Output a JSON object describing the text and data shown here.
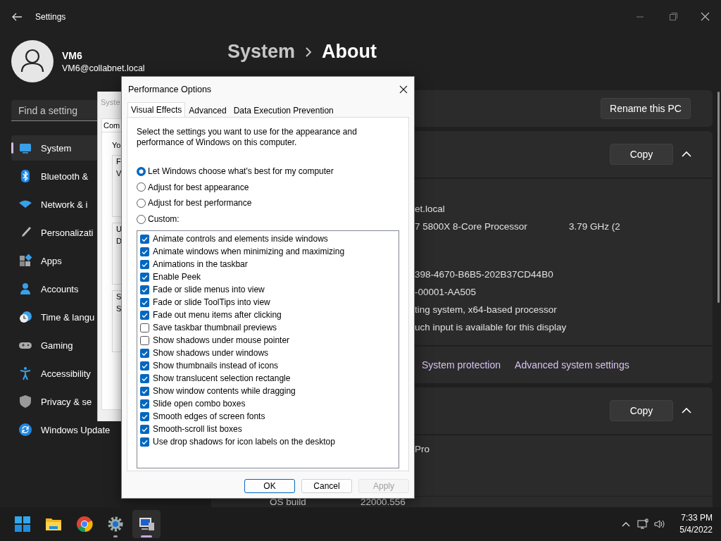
{
  "settings_window": {
    "title": "Settings"
  },
  "profile": {
    "name": "VM6",
    "email": "VM6@collabnet.local"
  },
  "search": {
    "placeholder": "Find a setting"
  },
  "sidebar": {
    "items": [
      {
        "label": "System",
        "selected": true
      },
      {
        "label": "Bluetooth &",
        "selected": false
      },
      {
        "label": "Network & i",
        "selected": false
      },
      {
        "label": "Personalizati",
        "selected": false
      },
      {
        "label": "Apps",
        "selected": false
      },
      {
        "label": "Accounts",
        "selected": false
      },
      {
        "label": "Time & langu",
        "selected": false
      },
      {
        "label": "Gaming",
        "selected": false
      },
      {
        "label": "Accessibility",
        "selected": false
      },
      {
        "label": "Privacy & se",
        "selected": false
      },
      {
        "label": "Windows Update",
        "selected": false
      }
    ]
  },
  "breadcrumb": [
    "System",
    "About"
  ],
  "rename_button": "Rename this PC",
  "device_specs": {
    "copy_button": "Copy",
    "expanded": true,
    "rows": [
      {
        "value": "et.local"
      },
      {
        "value": "7 5800X 8-Core Processor",
        "value_2": "3.79 GHz  (2"
      },
      {
        "value": "398-4670-B6B5-202B37CD44B0"
      },
      {
        "value": "-00001-AA505"
      },
      {
        "value": "ting system, x64-based processor"
      },
      {
        "value": "uch input is available for this display"
      }
    ]
  },
  "related_links": [
    "System protection",
    "Advanced system settings"
  ],
  "windows_specs": {
    "copy_button": "Copy",
    "expanded": true,
    "rows": [
      {
        "value": "Pro"
      }
    ],
    "os_build": {
      "label": "OS build",
      "value": "22000.556"
    }
  },
  "system_properties": {
    "title": "Syste",
    "tabs": [
      {
        "label": "Com",
        "selected": true
      }
    ],
    "text": "Yo",
    "groups": [
      [
        "F",
        "V"
      ],
      [
        "U",
        "D"
      ],
      [
        "S",
        "S"
      ]
    ]
  },
  "performance_options": {
    "title": "Performance Options",
    "tabs": [
      {
        "label": "Visual Effects",
        "selected": true
      },
      {
        "label": "Advanced",
        "selected": false
      },
      {
        "label": "Data Execution Prevention",
        "selected": false
      }
    ],
    "description": "Select the settings you want to use for the appearance and performance of Windows on this computer.",
    "options": [
      {
        "label": "Let Windows choose what's best for my computer",
        "selected": true
      },
      {
        "label": "Adjust for best appearance",
        "selected": false
      },
      {
        "label": "Adjust for best performance",
        "selected": false
      },
      {
        "label": "Custom:",
        "selected": false
      }
    ],
    "effects": [
      {
        "label": "Animate controls and elements inside windows",
        "checked": true
      },
      {
        "label": "Animate windows when minimizing and maximizing",
        "checked": true
      },
      {
        "label": "Animations in the taskbar",
        "checked": true
      },
      {
        "label": "Enable Peek",
        "checked": true
      },
      {
        "label": "Fade or slide menus into view",
        "checked": true
      },
      {
        "label": "Fade or slide ToolTips into view",
        "checked": true
      },
      {
        "label": "Fade out menu items after clicking",
        "checked": true
      },
      {
        "label": "Save taskbar thumbnail previews",
        "checked": false
      },
      {
        "label": "Show shadows under mouse pointer",
        "checked": false
      },
      {
        "label": "Show shadows under windows",
        "checked": true
      },
      {
        "label": "Show thumbnails instead of icons",
        "checked": true
      },
      {
        "label": "Show translucent selection rectangle",
        "checked": true
      },
      {
        "label": "Show window contents while dragging",
        "checked": true
      },
      {
        "label": "Slide open combo boxes",
        "checked": true
      },
      {
        "label": "Smooth edges of screen fonts",
        "checked": true
      },
      {
        "label": "Smooth-scroll list boxes",
        "checked": true
      },
      {
        "label": "Use drop shadows for icon labels on the desktop",
        "checked": true
      }
    ],
    "buttons": [
      {
        "label": "OK",
        "default": true,
        "disabled": false
      },
      {
        "label": "Cancel",
        "default": false,
        "disabled": false
      },
      {
        "label": "Apply",
        "default": false,
        "disabled": true
      }
    ]
  },
  "taskbar": {
    "apps": [
      {
        "running": false,
        "active": false
      },
      {
        "running": false,
        "active": false
      },
      {
        "running": false,
        "active": false
      },
      {
        "running": true,
        "active": false
      },
      {
        "running": true,
        "active": true
      }
    ],
    "clock": {
      "time": "7:33 PM",
      "date": "5/4/2022"
    }
  }
}
